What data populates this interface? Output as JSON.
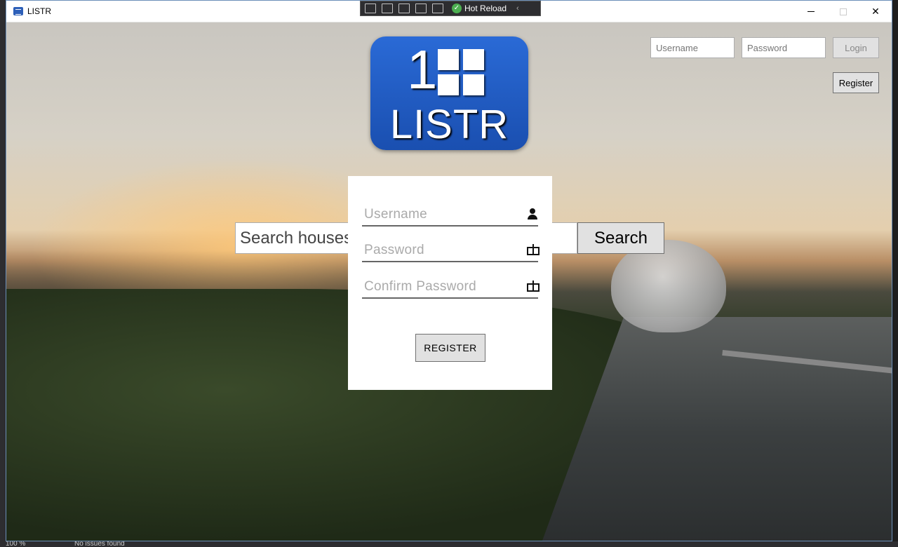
{
  "window": {
    "title": "LISTR"
  },
  "debug_toolbar": {
    "hot_reload_label": "Hot Reload"
  },
  "logo": {
    "number": "1",
    "word": "LISTR"
  },
  "header_login": {
    "username_placeholder": "Username",
    "password_placeholder": "Password",
    "login_label": "Login",
    "register_label": "Register"
  },
  "search": {
    "placeholder": "Search houses",
    "button_label": "Search"
  },
  "register_card": {
    "username_placeholder": "Username",
    "password_placeholder": "Password",
    "confirm_placeholder": "Confirm Password",
    "submit_label": "REGISTER"
  },
  "statusbar": {
    "zoom": "100 %",
    "issues": "No issues found"
  },
  "colors": {
    "logo_blue": "#1a4fb0",
    "button_gray": "#e1e1e1"
  }
}
